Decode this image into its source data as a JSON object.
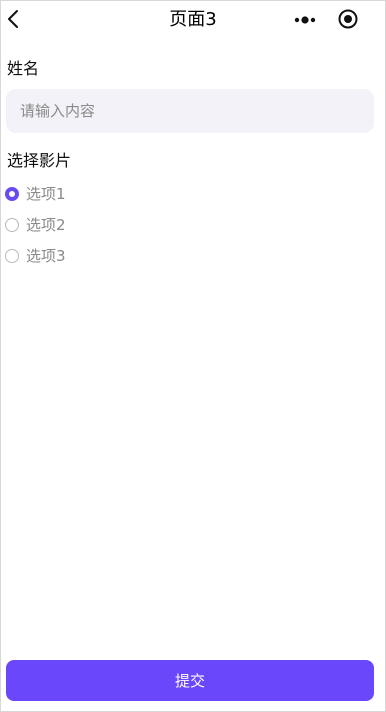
{
  "navbar": {
    "title": "页面3",
    "back_icon": "chevron-left-icon",
    "more_icon": "more-dots-icon",
    "close_icon": "target-circle-icon"
  },
  "form": {
    "name_label": "姓名",
    "name_placeholder": "请输入内容",
    "name_value": "",
    "film_label": "选择影片",
    "options": [
      {
        "label": "选项1",
        "selected": true
      },
      {
        "label": "选项2",
        "selected": false
      },
      {
        "label": "选项3",
        "selected": false
      }
    ],
    "submit_label": "提交"
  },
  "colors": {
    "accent": "#6b47fb",
    "input_bg": "#f2f2f8",
    "option_text": "#8a8a8a"
  }
}
